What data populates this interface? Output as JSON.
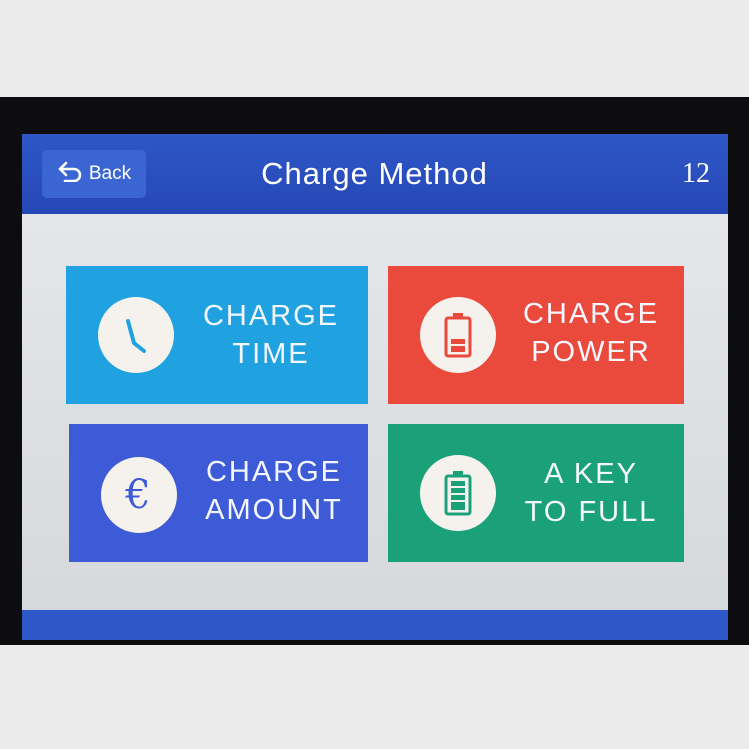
{
  "header": {
    "back_label": "Back",
    "title": "Charge Method",
    "counter": "12"
  },
  "tiles": [
    {
      "label": "CHARGE\nTIME",
      "icon": "clock-icon",
      "color": "#1fa2df"
    },
    {
      "label": "CHARGE\nPOWER",
      "icon": "battery-low-icon",
      "color": "#ea4a3b"
    },
    {
      "label": "CHARGE\nAMOUNT",
      "icon": "euro-icon",
      "glyph": "€",
      "color": "#3e5bd7"
    },
    {
      "label": "A KEY\nTO FULL",
      "icon": "battery-full-icon",
      "color": "#1aa17a"
    }
  ],
  "colors": {
    "header": "#2a4fbf",
    "screen_bg": "#dcdfe2",
    "icon_circle": "#f5f2ee"
  }
}
